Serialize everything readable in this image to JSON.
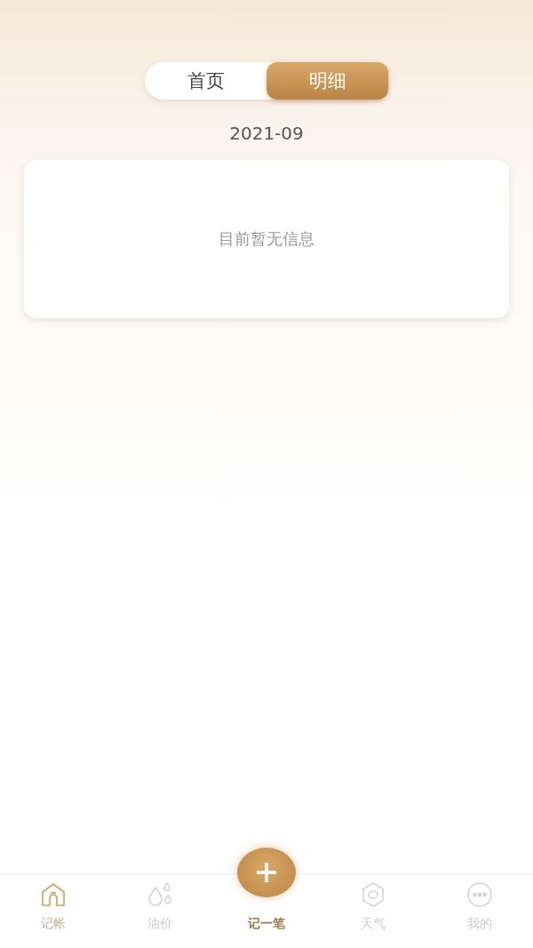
{
  "tabs": [
    {
      "label": "首页",
      "selected": false
    },
    {
      "label": "明细",
      "selected": true
    }
  ],
  "month": "2021-09",
  "empty_message": "目前暂无信息",
  "nav": [
    {
      "kind": "home",
      "label": "记帐",
      "selected": true
    },
    {
      "kind": "oil",
      "label": "油价",
      "selected": false
    },
    {
      "kind": "add",
      "label": "记一笔",
      "selected": false
    },
    {
      "kind": "weather",
      "label": "天气",
      "selected": false
    },
    {
      "kind": "more",
      "label": "我的",
      "selected": false
    }
  ]
}
